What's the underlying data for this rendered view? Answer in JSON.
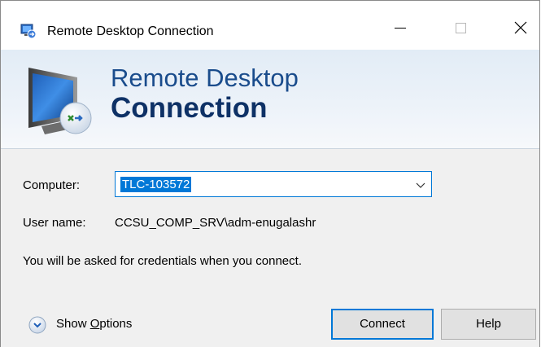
{
  "window": {
    "title": "Remote Desktop Connection",
    "controls": {
      "minimize": "minimize-icon",
      "maximize": "maximize-icon",
      "close": "close-icon"
    }
  },
  "banner": {
    "line1": "Remote Desktop",
    "line2": "Connection",
    "icon": "remote-desktop-monitor-icon"
  },
  "form": {
    "computer_label": "Computer:",
    "computer_value": "TLC-103572",
    "username_label": "User name:",
    "username_value": "CCSU_COMP_SRV\\adm-enugalashr",
    "credentials_note": "You will be asked for credentials when you connect."
  },
  "footer": {
    "show_options_pre": "Show ",
    "show_options_access": "O",
    "show_options_post": "ptions",
    "connect_label": "Connect",
    "help_label": "Help"
  },
  "colors": {
    "accent": "#0078d7",
    "banner_title": "#1a4c8c",
    "banner_title_bold": "#0e3166",
    "dialog_bg": "#f0f0f0"
  }
}
